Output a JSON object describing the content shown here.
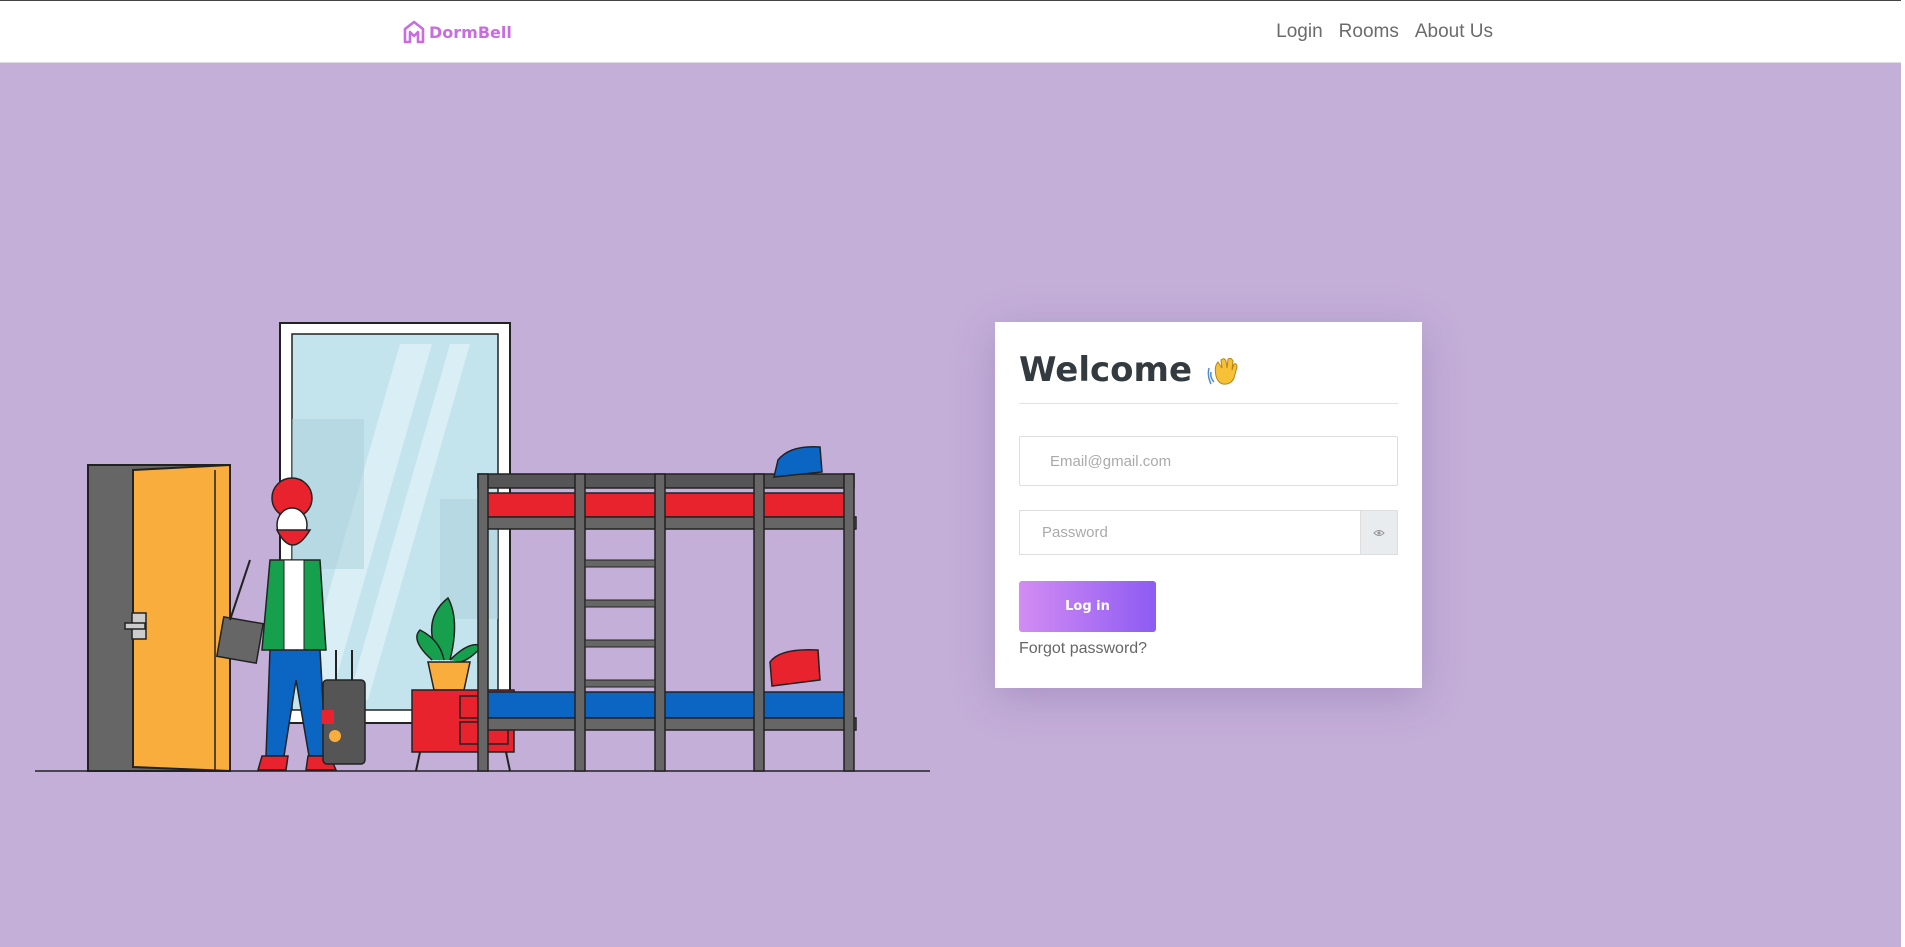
{
  "brand": {
    "name": "DormBell",
    "color": "#c96ce0"
  },
  "nav": {
    "items": [
      {
        "label": "Login"
      },
      {
        "label": "Rooms"
      },
      {
        "label": "About Us"
      }
    ]
  },
  "login_card": {
    "title": "Welcome",
    "title_icon": "waving-hand-icon",
    "email": {
      "placeholder": "Email@gmail.com",
      "value": ""
    },
    "password": {
      "placeholder": "Password",
      "value": "",
      "toggle_icon": "eye-icon"
    },
    "submit_label": "Log in",
    "forgot_label": "Forgot password?"
  },
  "colors": {
    "page_background": "#c4afd9",
    "button_gradient_start": "#d38cf3",
    "button_gradient_end": "#8d5bf3"
  },
  "illustration": {
    "icon": "dorm-room-illustration"
  }
}
